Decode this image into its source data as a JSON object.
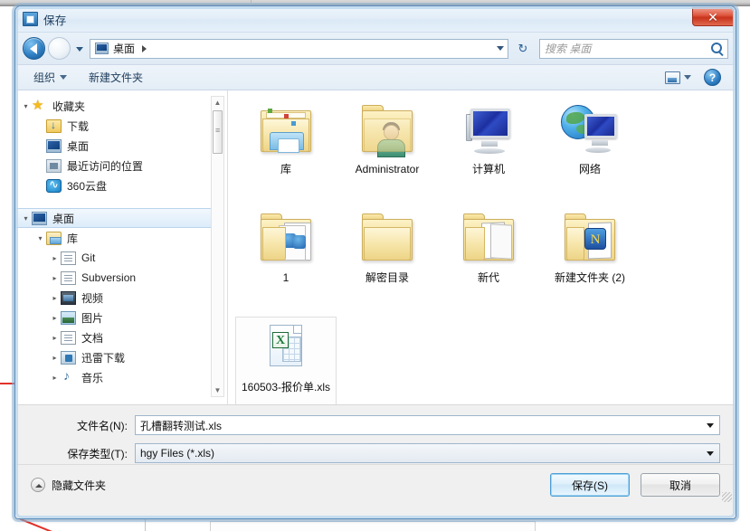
{
  "window": {
    "title": "保存",
    "close_label": "✕"
  },
  "nav": {
    "back_icon": "back-arrow-icon",
    "forward_icon": "forward-arrow-icon",
    "history_icon": "history-dropdown-icon",
    "address_value": "桌面",
    "address_separator": "▸",
    "refresh_icon": "↻",
    "search_placeholder": "搜索 桌面",
    "search_icon": "search-icon"
  },
  "toolbar": {
    "organize_label": "组织",
    "new_folder_label": "新建文件夹",
    "view_icon": "view-mode-icon",
    "help_label": "?"
  },
  "sidebar": {
    "groups": [
      {
        "header": {
          "label": "收藏夹",
          "arrow": "▾",
          "icon": "star-icon",
          "icon_class": "ico-star",
          "indent": 0
        },
        "items": [
          {
            "label": "下载",
            "icon": "downloads-icon",
            "icon_class": "ico-dl",
            "indent": 1,
            "arrow": ""
          },
          {
            "label": "桌面",
            "icon": "desktop-icon",
            "icon_class": "ico-desk",
            "indent": 1,
            "arrow": ""
          },
          {
            "label": "最近访问的位置",
            "icon": "recent-places-icon",
            "icon_class": "ico-recent",
            "indent": 1,
            "arrow": ""
          },
          {
            "label": "360云盘",
            "icon": "cloud-drive-icon",
            "icon_class": "ico-cloud",
            "indent": 1,
            "arrow": ""
          }
        ]
      },
      {
        "header": {
          "label": "桌面",
          "arrow": "▾",
          "icon": "desktop-icon",
          "icon_class": "ico-desk",
          "indent": 0,
          "selected": true
        },
        "items": [
          {
            "label": "库",
            "icon": "libraries-icon",
            "icon_class": "ico-lib",
            "indent": 1,
            "arrow": "▾"
          },
          {
            "label": "Git",
            "icon": "folder-icon",
            "icon_class": "ico-doc",
            "indent": 2,
            "arrow": "▸"
          },
          {
            "label": "Subversion",
            "icon": "folder-icon",
            "icon_class": "ico-doc",
            "indent": 2,
            "arrow": "▸"
          },
          {
            "label": "视频",
            "icon": "video-icon",
            "icon_class": "ico-vid",
            "indent": 2,
            "arrow": "▸"
          },
          {
            "label": "图片",
            "icon": "pictures-icon",
            "icon_class": "ico-pic",
            "indent": 2,
            "arrow": "▸"
          },
          {
            "label": "文档",
            "icon": "documents-icon",
            "icon_class": "ico-doc",
            "indent": 2,
            "arrow": "▸"
          },
          {
            "label": "迅雷下载",
            "icon": "thunder-download-icon",
            "icon_class": "ico-thunder",
            "indent": 2,
            "arrow": "▸"
          },
          {
            "label": "音乐",
            "icon": "music-icon",
            "icon_class": "ico-music",
            "indent": 2,
            "arrow": "▸"
          }
        ]
      }
    ],
    "scrollbar": {
      "up": "▲",
      "down": "▼"
    }
  },
  "files": [
    {
      "label": "库",
      "icon": "libraries-folder-icon",
      "kind": "libraries",
      "selected": false
    },
    {
      "label": "Administrator",
      "icon": "user-folder-icon",
      "kind": "user",
      "selected": false
    },
    {
      "label": "计算机",
      "icon": "computer-icon",
      "kind": "computer",
      "selected": false
    },
    {
      "label": "网络",
      "icon": "network-icon",
      "kind": "network",
      "selected": false
    },
    {
      "label": "1",
      "icon": "folder-stack-icon",
      "kind": "stack",
      "selected": false
    },
    {
      "label": "解密目录",
      "icon": "folder-icon",
      "kind": "folder",
      "selected": false
    },
    {
      "label": "新代",
      "icon": "folder-open-icon",
      "kind": "folder-open",
      "selected": false
    },
    {
      "label": "新建文件夹 (2)",
      "icon": "folder-app-icon",
      "kind": "folder-app",
      "selected": false
    },
    {
      "label": "160503-报价单.xls",
      "icon": "excel-file-icon",
      "kind": "xls",
      "selected": true
    }
  ],
  "form": {
    "filename_label": "文件名(N):",
    "filename_value": "孔槽翻转测试.xls",
    "filetype_label": "保存类型(T):",
    "filetype_value": "hgy Files (*.xls)"
  },
  "footer": {
    "hide_folders_label": "隐藏文件夹",
    "hide_folders_icon": "chevron-up-circle-icon",
    "save_label": "保存(S)",
    "cancel_label": "取消"
  },
  "colors": {
    "accent": "#2f7fc4",
    "close_red": "#c8331b",
    "selection_blue": "#dcecfa",
    "folder_yellow": "#f6e3a1"
  }
}
